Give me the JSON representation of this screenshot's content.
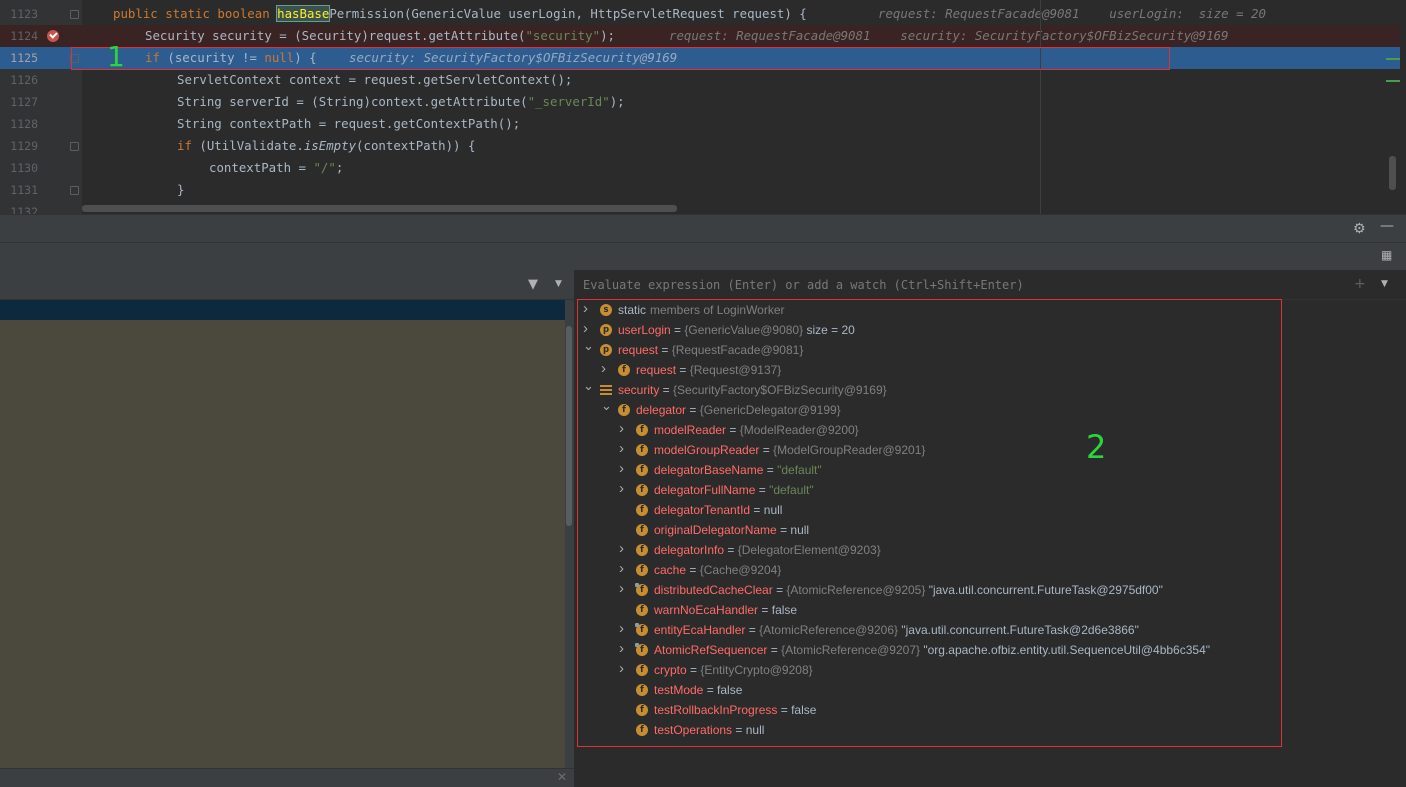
{
  "editor": {
    "lines": [
      {
        "n": "1123",
        "parts": [
          [
            "kw",
            "public static boolean "
          ],
          [
            "fnhl",
            "hasBase"
          ],
          [
            "fn",
            "Permission(GenericValue userLogin, HttpServletRequest request) {"
          ]
        ],
        "hint": "request: RequestFacade@9081    userLogin:  size = 20",
        "indent": 113,
        "hintLeft": 878
      },
      {
        "n": "1124",
        "parts": [
          [
            "p",
            "Security security = (Security)request.getAttribute("
          ],
          [
            "str",
            "\"security\""
          ],
          [
            "p",
            ");"
          ]
        ],
        "hint": "request: RequestFacade@9081    security: SecurityFactory$OFBizSecurity@9169",
        "indent": 145,
        "hintLeft": 669
      },
      {
        "n": "1125",
        "parts": [
          [
            "kw",
            "if "
          ],
          [
            "p",
            "(security != "
          ],
          [
            "kw",
            "null"
          ],
          [
            "p",
            ") {"
          ]
        ],
        "hint": "security: SecurityFactory$OFBizSecurity@9169",
        "indent": 145,
        "hintLeft": 349
      },
      {
        "n": "1126",
        "parts": [
          [
            "p",
            "ServletContext context = request.getServletContext();"
          ]
        ],
        "hint": "",
        "indent": 177,
        "hintLeft": 0
      },
      {
        "n": "1127",
        "parts": [
          [
            "p",
            "String serverId = (String)context.getAttribute("
          ],
          [
            "str",
            "\"_serverId\""
          ],
          [
            "p",
            ");"
          ]
        ],
        "hint": "",
        "indent": 177,
        "hintLeft": 0
      },
      {
        "n": "1128",
        "parts": [
          [
            "p",
            "String contextPath = request.getContextPath();"
          ]
        ],
        "hint": "",
        "indent": 177,
        "hintLeft": 0
      },
      {
        "n": "1129",
        "parts": [
          [
            "kw",
            "if "
          ],
          [
            "p",
            "(UtilValidate."
          ],
          [
            "it",
            "isEmpty"
          ],
          [
            "p",
            "(contextPath)) {"
          ]
        ],
        "hint": "",
        "indent": 177,
        "hintLeft": 0
      },
      {
        "n": "1130",
        "parts": [
          [
            "p",
            "contextPath = "
          ],
          [
            "str",
            "\"/\""
          ],
          [
            "p",
            ";"
          ]
        ],
        "hint": "",
        "indent": 209,
        "hintLeft": 0
      },
      {
        "n": "1131",
        "parts": [
          [
            "p",
            "}"
          ]
        ],
        "hint": "",
        "indent": 177,
        "hintLeft": 0
      },
      {
        "n": "1132",
        "parts": [],
        "hint": "",
        "indent": 177,
        "hintLeft": 0
      }
    ],
    "annotation_1": "1"
  },
  "debug": {
    "settings_icon": "gear-icon",
    "minimize_icon": "minimize-icon",
    "layout_icon": "layout-icon",
    "filter_icon": "filter-icon",
    "eval_placeholder": "Evaluate expression (Enter) or add a watch (Ctrl+Shift+Enter)",
    "annotation_2": "2"
  },
  "variables": [
    {
      "level": 0,
      "toggle": "collapsed",
      "badge": "s",
      "name": "static",
      "static": true,
      "eq": "",
      "type": "members of LoginWorker",
      "value": "",
      "valueKind": ""
    },
    {
      "level": 0,
      "toggle": "collapsed",
      "badge": "p",
      "name": "userLogin",
      "eq": " = ",
      "type": "{GenericValue@9080}",
      "value": " size = 20",
      "valueKind": "val"
    },
    {
      "level": 0,
      "toggle": "expanded",
      "badge": "p",
      "name": "request",
      "eq": " = ",
      "type": "{RequestFacade@9081}",
      "value": "",
      "valueKind": ""
    },
    {
      "level": 1,
      "toggle": "collapsed",
      "badge": "f",
      "name": "request",
      "eq": " = ",
      "type": "{Request@9137}",
      "value": "",
      "valueKind": ""
    },
    {
      "level": 0,
      "toggle": "expanded",
      "badge": "list",
      "name": "security",
      "eq": " = ",
      "type": "{SecurityFactory$OFBizSecurity@9169}",
      "value": "",
      "valueKind": ""
    },
    {
      "level": 1,
      "toggle": "expanded",
      "badge": "f",
      "name": "delegator",
      "eq": " = ",
      "type": "{GenericDelegator@9199}",
      "value": "",
      "valueKind": ""
    },
    {
      "level": 2,
      "toggle": "collapsed",
      "badge": "f",
      "name": "modelReader",
      "eq": " = ",
      "type": "{ModelReader@9200}",
      "value": "",
      "valueKind": ""
    },
    {
      "level": 2,
      "toggle": "collapsed",
      "badge": "f",
      "name": "modelGroupReader",
      "eq": " = ",
      "type": "{ModelGroupReader@9201}",
      "value": "",
      "valueKind": ""
    },
    {
      "level": 2,
      "toggle": "collapsed",
      "badge": "f",
      "name": "delegatorBaseName",
      "eq": " = ",
      "type": "",
      "value": "\"default\"",
      "valueKind": "str"
    },
    {
      "level": 2,
      "toggle": "collapsed",
      "badge": "f",
      "name": "delegatorFullName",
      "eq": " = ",
      "type": "",
      "value": "\"default\"",
      "valueKind": "str"
    },
    {
      "level": 2,
      "toggle": "none",
      "badge": "f",
      "name": "delegatorTenantId",
      "eq": " = ",
      "type": "",
      "value": "null",
      "valueKind": "val"
    },
    {
      "level": 2,
      "toggle": "none",
      "badge": "f",
      "name": "originalDelegatorName",
      "eq": " = ",
      "type": "",
      "value": "null",
      "valueKind": "val"
    },
    {
      "level": 2,
      "toggle": "collapsed",
      "badge": "f",
      "name": "delegatorInfo",
      "eq": " = ",
      "type": "{DelegatorElement@9203}",
      "value": "",
      "valueKind": ""
    },
    {
      "level": 2,
      "toggle": "collapsed",
      "badge": "f",
      "name": "cache",
      "eq": " = ",
      "type": "{Cache@9204}",
      "value": "",
      "valueKind": ""
    },
    {
      "level": 2,
      "toggle": "collapsed",
      "badge": "flock",
      "name": "distributedCacheClear",
      "eq": " = ",
      "type": "{AtomicReference@9205}",
      "value": " \"java.util.concurrent.FutureTask@2975df00\"",
      "valueKind": "val"
    },
    {
      "level": 2,
      "toggle": "none",
      "badge": "f",
      "name": "warnNoEcaHandler",
      "eq": " = ",
      "type": "",
      "value": "false",
      "valueKind": "val"
    },
    {
      "level": 2,
      "toggle": "collapsed",
      "badge": "flock",
      "name": "entityEcaHandler",
      "eq": " = ",
      "type": "{AtomicReference@9206}",
      "value": " \"java.util.concurrent.FutureTask@2d6e3866\"",
      "valueKind": "val"
    },
    {
      "level": 2,
      "toggle": "collapsed",
      "badge": "flock",
      "name": "AtomicRefSequencer",
      "eq": " = ",
      "type": "{AtomicReference@9207}",
      "value": " \"org.apache.ofbiz.entity.util.SequenceUtil@4bb6c354\"",
      "valueKind": "val"
    },
    {
      "level": 2,
      "toggle": "collapsed",
      "badge": "f",
      "name": "crypto",
      "eq": " = ",
      "type": "{EntityCrypto@9208}",
      "value": "",
      "valueKind": ""
    },
    {
      "level": 2,
      "toggle": "none",
      "badge": "f",
      "name": "testMode",
      "eq": " = ",
      "type": "",
      "value": "false",
      "valueKind": "val"
    },
    {
      "level": 2,
      "toggle": "none",
      "badge": "f",
      "name": "testRollbackInProgress",
      "eq": " = ",
      "type": "",
      "value": "false",
      "valueKind": "val"
    },
    {
      "level": 2,
      "toggle": "none",
      "badge": "f",
      "name": "testOperations",
      "eq": " = ",
      "type": "",
      "value": "null",
      "valueKind": "val"
    }
  ]
}
